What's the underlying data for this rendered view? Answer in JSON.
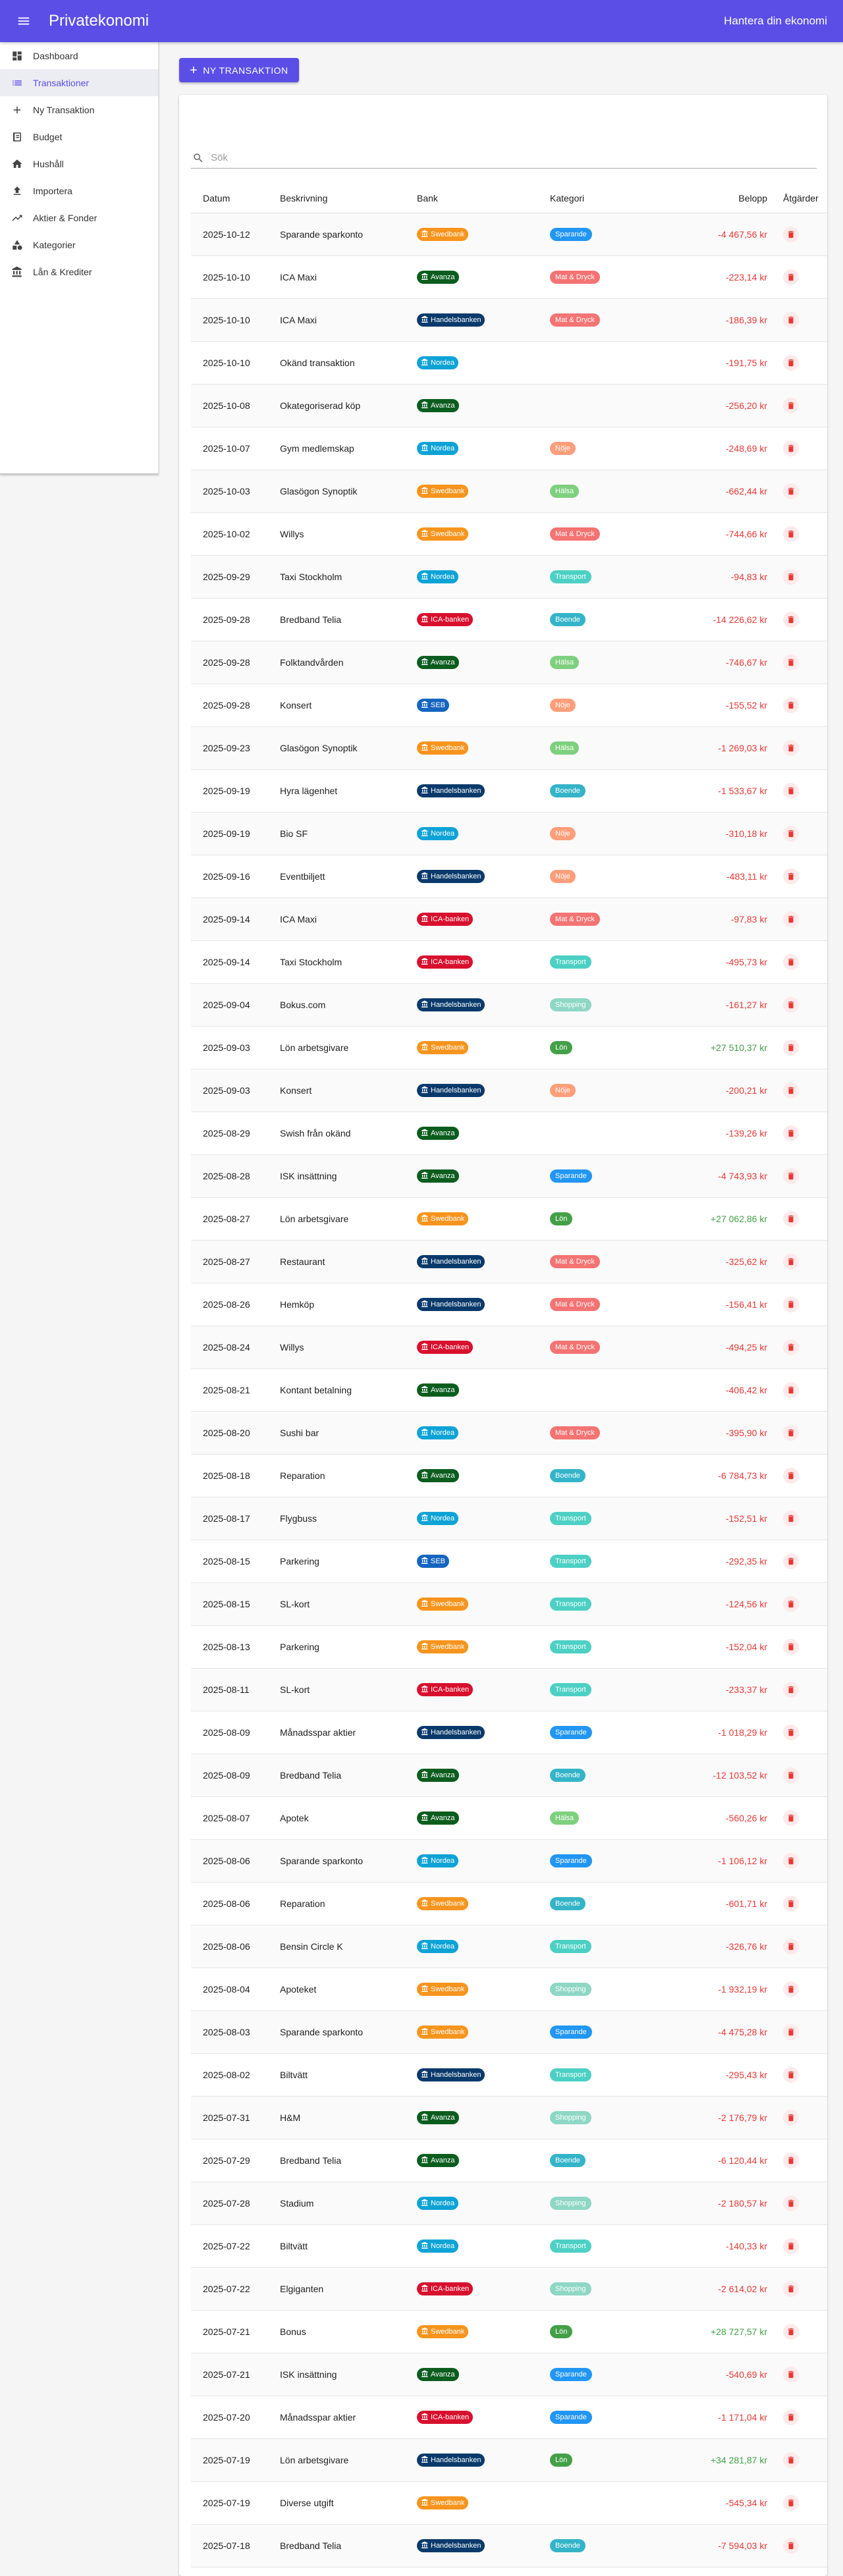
{
  "app": {
    "title": "Privatekonomi",
    "right_text": "Hantera din ekonomi"
  },
  "sidebar": {
    "items": [
      {
        "label": "Dashboard",
        "icon": "dashboard-icon"
      },
      {
        "label": "Transaktioner",
        "icon": "list-icon",
        "active": true
      },
      {
        "label": "Ny Transaktion",
        "icon": "plus-icon"
      },
      {
        "label": "Budget",
        "icon": "budget-icon"
      },
      {
        "label": "Hushåll",
        "icon": "home-icon"
      },
      {
        "label": "Importera",
        "icon": "upload-icon"
      },
      {
        "label": "Aktier & Fonder",
        "icon": "trending-up-icon"
      },
      {
        "label": "Kategorier",
        "icon": "category-icon"
      },
      {
        "label": "Lån & Krediter",
        "icon": "bank-icon"
      }
    ]
  },
  "toolbar": {
    "add_label": "NY TRANSAKTION"
  },
  "search": {
    "placeholder": "Sök"
  },
  "table": {
    "headers": {
      "date": "Datum",
      "desc": "Beskrivning",
      "bank": "Bank",
      "cat": "Kategori",
      "amount": "Belopp",
      "actions": "Åtgärder"
    },
    "bank_colors": {
      "Swedbank": "#f7941d",
      "Avanza": "#0b5d1e",
      "Handelsbanken": "#0a3a6b",
      "Nordea": "#0ea3d6",
      "ICA-banken": "#d8102e",
      "SEB": "#1565c0"
    },
    "category_colors": {
      "Sparande": "#2196f3",
      "Mat & Dryck": "#f47373",
      "Nöje": "#ff9e7a",
      "Hälsa": "#7ed07e",
      "Transport": "#4dd0c4",
      "Boende": "#34b4c8",
      "Shopping": "#8ed7c4",
      "Lön": "#43a047"
    },
    "rows": [
      {
        "date": "2025-10-12",
        "desc": "Sparande sparkonto",
        "bank": "Swedbank",
        "cat": "Sparande",
        "amount": "-4 467,56 kr",
        "sign": "neg"
      },
      {
        "date": "2025-10-10",
        "desc": "ICA Maxi",
        "bank": "Avanza",
        "cat": "Mat & Dryck",
        "amount": "-223,14 kr",
        "sign": "neg"
      },
      {
        "date": "2025-10-10",
        "desc": "ICA Maxi",
        "bank": "Handelsbanken",
        "cat": "Mat & Dryck",
        "amount": "-186,39 kr",
        "sign": "neg"
      },
      {
        "date": "2025-10-10",
        "desc": "Okänd transaktion",
        "bank": "Nordea",
        "cat": "",
        "amount": "-191,75 kr",
        "sign": "neg"
      },
      {
        "date": "2025-10-08",
        "desc": "Okategoriserad köp",
        "bank": "Avanza",
        "cat": "",
        "amount": "-256,20 kr",
        "sign": "neg"
      },
      {
        "date": "2025-10-07",
        "desc": "Gym medlemskap",
        "bank": "Nordea",
        "cat": "Nöje",
        "amount": "-248,69 kr",
        "sign": "neg"
      },
      {
        "date": "2025-10-03",
        "desc": "Glasögon Synoptik",
        "bank": "Swedbank",
        "cat": "Hälsa",
        "amount": "-662,44 kr",
        "sign": "neg"
      },
      {
        "date": "2025-10-02",
        "desc": "Willys",
        "bank": "Swedbank",
        "cat": "Mat & Dryck",
        "amount": "-744,66 kr",
        "sign": "neg"
      },
      {
        "date": "2025-09-29",
        "desc": "Taxi Stockholm",
        "bank": "Nordea",
        "cat": "Transport",
        "amount": "-94,83 kr",
        "sign": "neg"
      },
      {
        "date": "2025-09-28",
        "desc": "Bredband Telia",
        "bank": "ICA-banken",
        "cat": "Boende",
        "amount": "-14 226,62 kr",
        "sign": "neg"
      },
      {
        "date": "2025-09-28",
        "desc": "Folktandvården",
        "bank": "Avanza",
        "cat": "Hälsa",
        "amount": "-746,67 kr",
        "sign": "neg"
      },
      {
        "date": "2025-09-28",
        "desc": "Konsert",
        "bank": "SEB",
        "cat": "Nöje",
        "amount": "-155,52 kr",
        "sign": "neg"
      },
      {
        "date": "2025-09-23",
        "desc": "Glasögon Synoptik",
        "bank": "Swedbank",
        "cat": "Hälsa",
        "amount": "-1 269,03 kr",
        "sign": "neg"
      },
      {
        "date": "2025-09-19",
        "desc": "Hyra lägenhet",
        "bank": "Handelsbanken",
        "cat": "Boende",
        "amount": "-1 533,67 kr",
        "sign": "neg"
      },
      {
        "date": "2025-09-19",
        "desc": "Bio SF",
        "bank": "Nordea",
        "cat": "Nöje",
        "amount": "-310,18 kr",
        "sign": "neg"
      },
      {
        "date": "2025-09-16",
        "desc": "Eventbiljett",
        "bank": "Handelsbanken",
        "cat": "Nöje",
        "amount": "-483,11 kr",
        "sign": "neg"
      },
      {
        "date": "2025-09-14",
        "desc": "ICA Maxi",
        "bank": "ICA-banken",
        "cat": "Mat & Dryck",
        "amount": "-97,83 kr",
        "sign": "neg"
      },
      {
        "date": "2025-09-14",
        "desc": "Taxi Stockholm",
        "bank": "ICA-banken",
        "cat": "Transport",
        "amount": "-495,73 kr",
        "sign": "neg"
      },
      {
        "date": "2025-09-04",
        "desc": "Bokus.com",
        "bank": "Handelsbanken",
        "cat": "Shopping",
        "amount": "-161,27 kr",
        "sign": "neg"
      },
      {
        "date": "2025-09-03",
        "desc": "Lön arbetsgivare",
        "bank": "Swedbank",
        "cat": "Lön",
        "amount": "+27 510,37 kr",
        "sign": "pos"
      },
      {
        "date": "2025-09-03",
        "desc": "Konsert",
        "bank": "Handelsbanken",
        "cat": "Nöje",
        "amount": "-200,21 kr",
        "sign": "neg"
      },
      {
        "date": "2025-08-29",
        "desc": "Swish från okänd",
        "bank": "Avanza",
        "cat": "",
        "amount": "-139,26 kr",
        "sign": "neg"
      },
      {
        "date": "2025-08-28",
        "desc": "ISK insättning",
        "bank": "Avanza",
        "cat": "Sparande",
        "amount": "-4 743,93 kr",
        "sign": "neg"
      },
      {
        "date": "2025-08-27",
        "desc": "Lön arbetsgivare",
        "bank": "Swedbank",
        "cat": "Lön",
        "amount": "+27 062,86 kr",
        "sign": "pos"
      },
      {
        "date": "2025-08-27",
        "desc": "Restaurant",
        "bank": "Handelsbanken",
        "cat": "Mat & Dryck",
        "amount": "-325,62 kr",
        "sign": "neg"
      },
      {
        "date": "2025-08-26",
        "desc": "Hemköp",
        "bank": "Handelsbanken",
        "cat": "Mat & Dryck",
        "amount": "-156,41 kr",
        "sign": "neg"
      },
      {
        "date": "2025-08-24",
        "desc": "Willys",
        "bank": "ICA-banken",
        "cat": "Mat & Dryck",
        "amount": "-494,25 kr",
        "sign": "neg"
      },
      {
        "date": "2025-08-21",
        "desc": "Kontant betalning",
        "bank": "Avanza",
        "cat": "",
        "amount": "-406,42 kr",
        "sign": "neg"
      },
      {
        "date": "2025-08-20",
        "desc": "Sushi bar",
        "bank": "Nordea",
        "cat": "Mat & Dryck",
        "amount": "-395,90 kr",
        "sign": "neg"
      },
      {
        "date": "2025-08-18",
        "desc": "Reparation",
        "bank": "Avanza",
        "cat": "Boende",
        "amount": "-6 784,73 kr",
        "sign": "neg"
      },
      {
        "date": "2025-08-17",
        "desc": "Flygbuss",
        "bank": "Nordea",
        "cat": "Transport",
        "amount": "-152,51 kr",
        "sign": "neg"
      },
      {
        "date": "2025-08-15",
        "desc": "Parkering",
        "bank": "SEB",
        "cat": "Transport",
        "amount": "-292,35 kr",
        "sign": "neg"
      },
      {
        "date": "2025-08-15",
        "desc": "SL-kort",
        "bank": "Swedbank",
        "cat": "Transport",
        "amount": "-124,56 kr",
        "sign": "neg"
      },
      {
        "date": "2025-08-13",
        "desc": "Parkering",
        "bank": "Swedbank",
        "cat": "Transport",
        "amount": "-152,04 kr",
        "sign": "neg"
      },
      {
        "date": "2025-08-11",
        "desc": "SL-kort",
        "bank": "ICA-banken",
        "cat": "Transport",
        "amount": "-233,37 kr",
        "sign": "neg"
      },
      {
        "date": "2025-08-09",
        "desc": "Månadsspar aktier",
        "bank": "Handelsbanken",
        "cat": "Sparande",
        "amount": "-1 018,29 kr",
        "sign": "neg"
      },
      {
        "date": "2025-08-09",
        "desc": "Bredband Telia",
        "bank": "Avanza",
        "cat": "Boende",
        "amount": "-12 103,52 kr",
        "sign": "neg"
      },
      {
        "date": "2025-08-07",
        "desc": "Apotek",
        "bank": "Avanza",
        "cat": "Hälsa",
        "amount": "-560,26 kr",
        "sign": "neg"
      },
      {
        "date": "2025-08-06",
        "desc": "Sparande sparkonto",
        "bank": "Nordea",
        "cat": "Sparande",
        "amount": "-1 106,12 kr",
        "sign": "neg"
      },
      {
        "date": "2025-08-06",
        "desc": "Reparation",
        "bank": "Swedbank",
        "cat": "Boende",
        "amount": "-601,71 kr",
        "sign": "neg"
      },
      {
        "date": "2025-08-06",
        "desc": "Bensin Circle K",
        "bank": "Nordea",
        "cat": "Transport",
        "amount": "-326,76 kr",
        "sign": "neg"
      },
      {
        "date": "2025-08-04",
        "desc": "Apoteket",
        "bank": "Swedbank",
        "cat": "Shopping",
        "amount": "-1 932,19 kr",
        "sign": "neg"
      },
      {
        "date": "2025-08-03",
        "desc": "Sparande sparkonto",
        "bank": "Swedbank",
        "cat": "Sparande",
        "amount": "-4 475,28 kr",
        "sign": "neg"
      },
      {
        "date": "2025-08-02",
        "desc": "Biltvätt",
        "bank": "Handelsbanken",
        "cat": "Transport",
        "amount": "-295,43 kr",
        "sign": "neg"
      },
      {
        "date": "2025-07-31",
        "desc": "H&M",
        "bank": "Avanza",
        "cat": "Shopping",
        "amount": "-2 176,79 kr",
        "sign": "neg"
      },
      {
        "date": "2025-07-29",
        "desc": "Bredband Telia",
        "bank": "Avanza",
        "cat": "Boende",
        "amount": "-6 120,44 kr",
        "sign": "neg"
      },
      {
        "date": "2025-07-28",
        "desc": "Stadium",
        "bank": "Nordea",
        "cat": "Shopping",
        "amount": "-2 180,57 kr",
        "sign": "neg"
      },
      {
        "date": "2025-07-22",
        "desc": "Biltvätt",
        "bank": "Nordea",
        "cat": "Transport",
        "amount": "-140,33 kr",
        "sign": "neg"
      },
      {
        "date": "2025-07-22",
        "desc": "Elgiganten",
        "bank": "ICA-banken",
        "cat": "Shopping",
        "amount": "-2 614,02 kr",
        "sign": "neg"
      },
      {
        "date": "2025-07-21",
        "desc": "Bonus",
        "bank": "Swedbank",
        "cat": "Lön",
        "amount": "+28 727,57 kr",
        "sign": "pos"
      },
      {
        "date": "2025-07-21",
        "desc": "ISK insättning",
        "bank": "Avanza",
        "cat": "Sparande",
        "amount": "-540,69 kr",
        "sign": "neg"
      },
      {
        "date": "2025-07-20",
        "desc": "Månadsspar aktier",
        "bank": "ICA-banken",
        "cat": "Sparande",
        "amount": "-1 171,04 kr",
        "sign": "neg"
      },
      {
        "date": "2025-07-19",
        "desc": "Lön arbetsgivare",
        "bank": "Handelsbanken",
        "cat": "Lön",
        "amount": "+34 281,87 kr",
        "sign": "pos"
      },
      {
        "date": "2025-07-19",
        "desc": "Diverse utgift",
        "bank": "Swedbank",
        "cat": "",
        "amount": "-545,34 kr",
        "sign": "neg"
      },
      {
        "date": "2025-07-18",
        "desc": "Bredband Telia",
        "bank": "Handelsbanken",
        "cat": "Boende",
        "amount": "-7 594,03 kr",
        "sign": "neg"
      }
    ]
  }
}
